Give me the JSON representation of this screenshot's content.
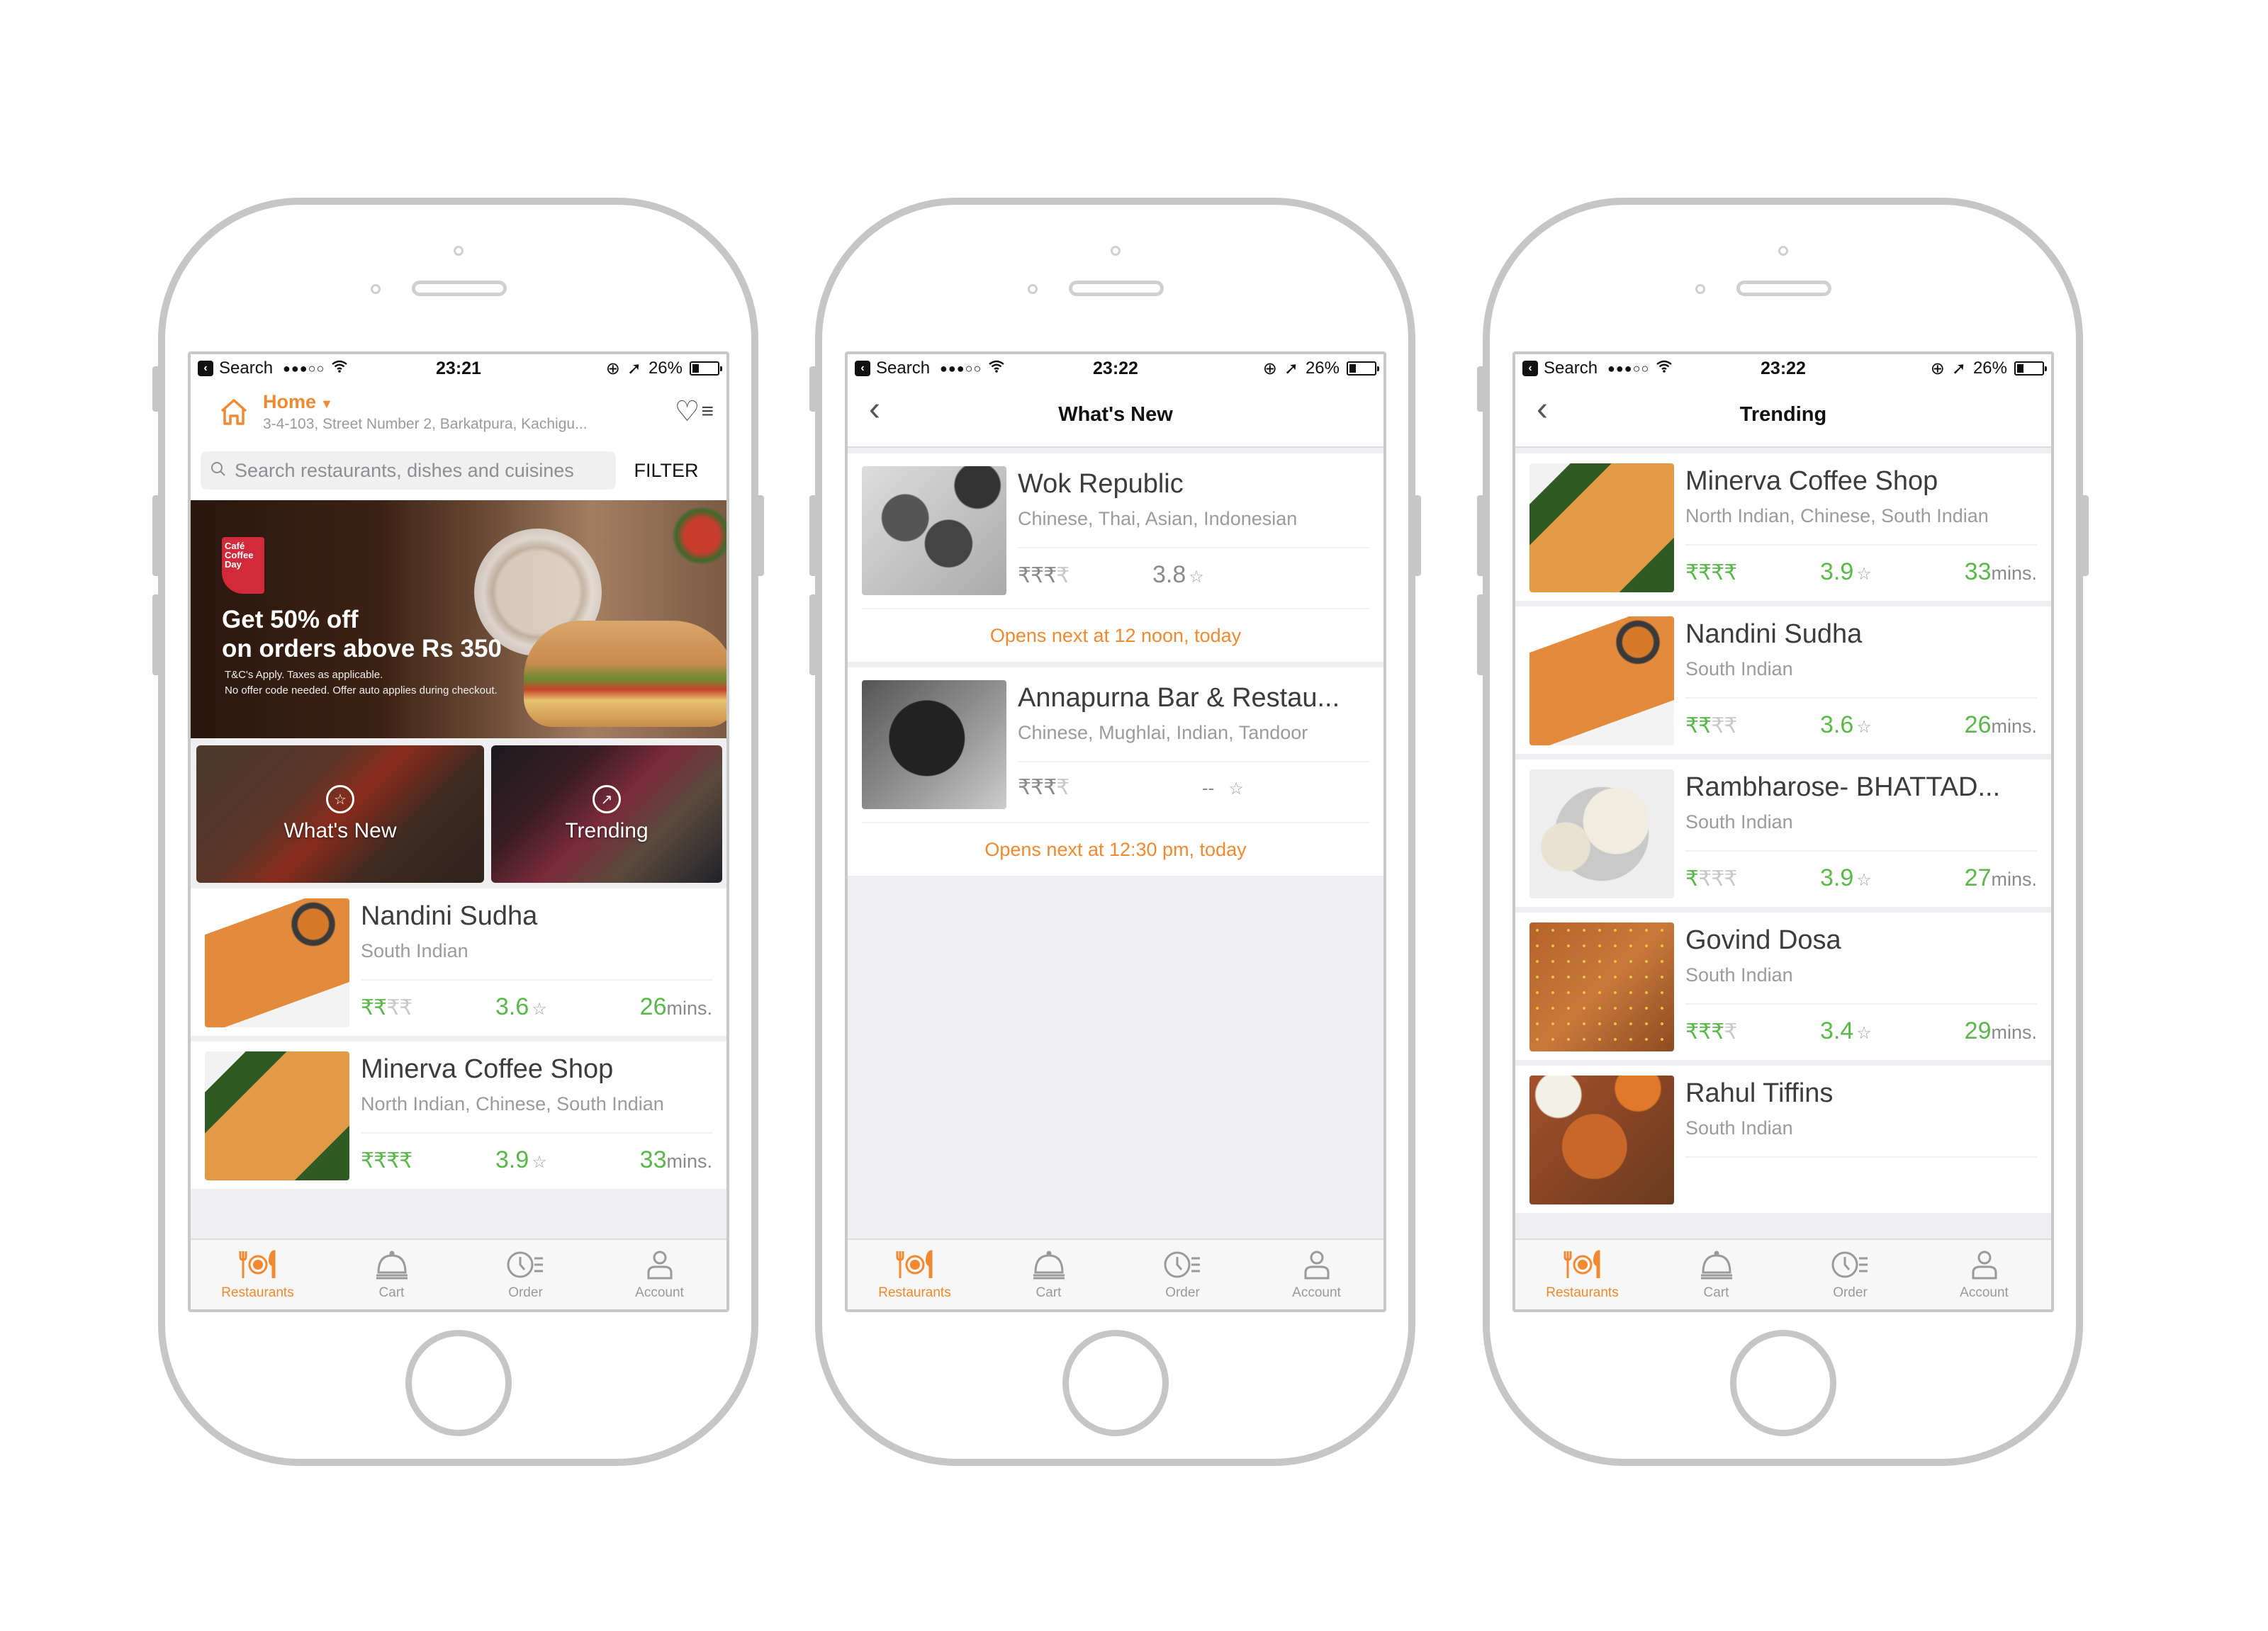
{
  "status_bar": {
    "back_app_label": "Search",
    "signal": "●●●○○",
    "battery": "26%",
    "battery_level": 0.26
  },
  "colors": {
    "accent": "#f0892f",
    "green": "#5ab84a",
    "muted": "#9b9b9b",
    "frame": "#c6c6c6"
  },
  "phones": [
    {
      "time": "23:21",
      "header": {
        "location_label": "Home",
        "address": "3-4-103, Street Number 2, Barkatpura, Kachigu...",
        "favorites_icon": "heart-icon",
        "menu_icon": "menu-icon"
      },
      "search": {
        "placeholder": "Search restaurants, dishes and cuisines",
        "filter_label": "FILTER"
      },
      "promo": {
        "brand": "Café Coffee Day",
        "headline_1": "Get 50% off",
        "headline_2": "on orders above Rs 350",
        "fine_1": "T&C's Apply. Taxes as applicable.",
        "fine_2": "No offer code needed. Offer auto applies during checkout."
      },
      "tiles": [
        {
          "label": "What's New",
          "icon": "star-icon"
        },
        {
          "label": "Trending",
          "icon": "trending-icon"
        }
      ],
      "restaurants": [
        {
          "name": "Nandini Sudha",
          "cuisine": "South Indian",
          "price_level": 2,
          "price_max": 4,
          "rating": "3.6",
          "eta": "26",
          "eta_unit": "mins."
        },
        {
          "name": "Minerva Coffee Shop",
          "cuisine": "North Indian, Chinese, South Indian",
          "price_level": 4,
          "price_max": 4,
          "rating": "3.9",
          "eta": "33",
          "eta_unit": "mins."
        }
      ]
    },
    {
      "time": "23:22",
      "title": "What's New",
      "restaurants": [
        {
          "name": "Wok Republic",
          "cuisine": "Chinese, Thai, Asian, Indonesian",
          "price_level": 3,
          "price_max": 4,
          "rating": "3.8",
          "opens": "Opens next at 12 noon, today"
        },
        {
          "name": "Annapurna Bar & Restau...",
          "cuisine": "Chinese, Mughlai, Indian, Tandoor",
          "price_level": 3,
          "price_max": 4,
          "rating": "--",
          "opens": "Opens next at 12:30 pm, today"
        }
      ]
    },
    {
      "time": "23:22",
      "title": "Trending",
      "restaurants": [
        {
          "name": "Minerva Coffee Shop",
          "cuisine": "North Indian, Chinese, South Indian",
          "price_level": 4,
          "price_max": 4,
          "rating": "3.9",
          "eta": "33",
          "eta_unit": "mins."
        },
        {
          "name": "Nandini Sudha",
          "cuisine": "South Indian",
          "price_level": 2,
          "price_max": 4,
          "rating": "3.6",
          "eta": "26",
          "eta_unit": "mins."
        },
        {
          "name": "Rambharose- BHATTAD...",
          "cuisine": "South Indian",
          "price_level": 1,
          "price_max": 4,
          "rating": "3.9",
          "eta": "27",
          "eta_unit": "mins."
        },
        {
          "name": "Govind Dosa",
          "cuisine": "South Indian",
          "price_level": 3,
          "price_max": 4,
          "rating": "3.4",
          "eta": "29",
          "eta_unit": "mins."
        },
        {
          "name": "Rahul Tiffins",
          "cuisine": "South Indian"
        }
      ]
    }
  ],
  "tabbar": [
    {
      "label": "Restaurants",
      "icon": "restaurants-icon",
      "active": true
    },
    {
      "label": "Cart",
      "icon": "cart-cloche-icon",
      "active": false
    },
    {
      "label": "Order",
      "icon": "order-history-icon",
      "active": false
    },
    {
      "label": "Account",
      "icon": "account-icon",
      "active": false
    }
  ],
  "symbols": {
    "rupee": "₹",
    "star": "☆",
    "back_chevron": "‹"
  }
}
